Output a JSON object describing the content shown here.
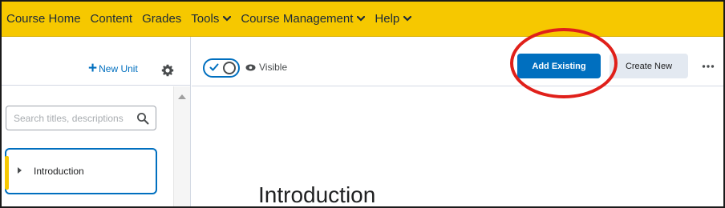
{
  "nav": {
    "items": [
      {
        "label": "Course Home",
        "dropdown": false
      },
      {
        "label": "Content",
        "dropdown": false
      },
      {
        "label": "Grades",
        "dropdown": false
      },
      {
        "label": "Tools",
        "dropdown": true
      },
      {
        "label": "Course Management",
        "dropdown": true
      },
      {
        "label": "Help",
        "dropdown": true
      }
    ]
  },
  "sidebar": {
    "new_unit_label": "New Unit",
    "search_placeholder": "Search titles, descriptions",
    "units": [
      {
        "label": "Introduction"
      }
    ]
  },
  "toolbar": {
    "visibility_label": "Visible",
    "visibility_on": true,
    "add_existing_label": "Add Existing",
    "create_new_label": "Create New"
  },
  "content": {
    "title": "Introduction"
  },
  "colors": {
    "nav_bg": "#f6c800",
    "primary": "#006fbf",
    "secondary_button": "#e3e9f1",
    "highlight": "#e0201a"
  },
  "icons": [
    "chevron-down-icon",
    "plus-icon",
    "gear-icon",
    "search-icon",
    "caret-right-icon",
    "check-icon",
    "eye-icon",
    "more-horizontal-icon"
  ]
}
